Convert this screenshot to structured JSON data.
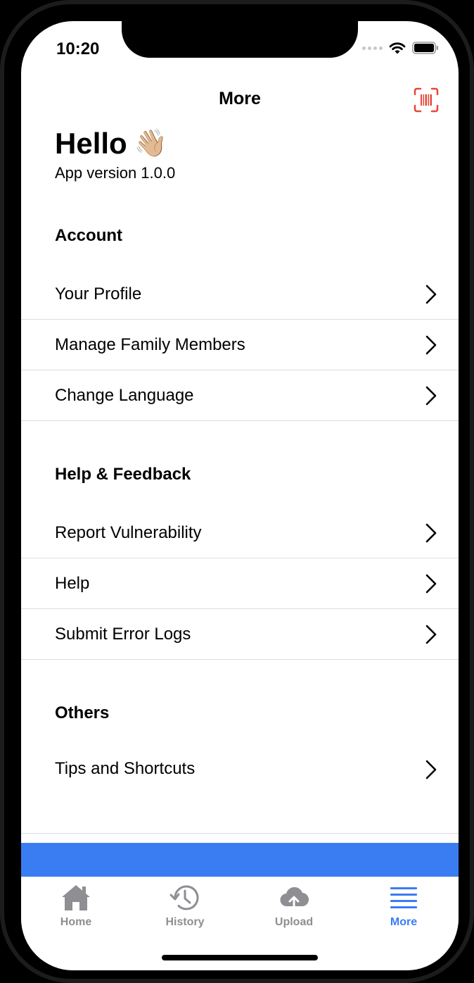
{
  "status": {
    "time": "10:20"
  },
  "nav": {
    "title": "More",
    "scan_icon": "barcode-scan-icon"
  },
  "greeting": {
    "title": "Hello",
    "emoji": "👋🏼",
    "version": "App version 1.0.0"
  },
  "sections": {
    "account": {
      "title": "Account",
      "items": [
        "Your Profile",
        "Manage Family Members",
        "Change Language"
      ]
    },
    "help": {
      "title": "Help & Feedback",
      "items": [
        "Report Vulnerability",
        "Help",
        "Submit Error Logs"
      ]
    },
    "others": {
      "title": "Others",
      "items": [
        "Tips and Shortcuts"
      ]
    }
  },
  "tabs": {
    "home": "Home",
    "history": "History",
    "upload": "Upload",
    "more": "More"
  },
  "colors": {
    "accent": "#3a7cf2",
    "scan_icon": "#e8473a",
    "inactive_tab": "#8e8e93"
  }
}
